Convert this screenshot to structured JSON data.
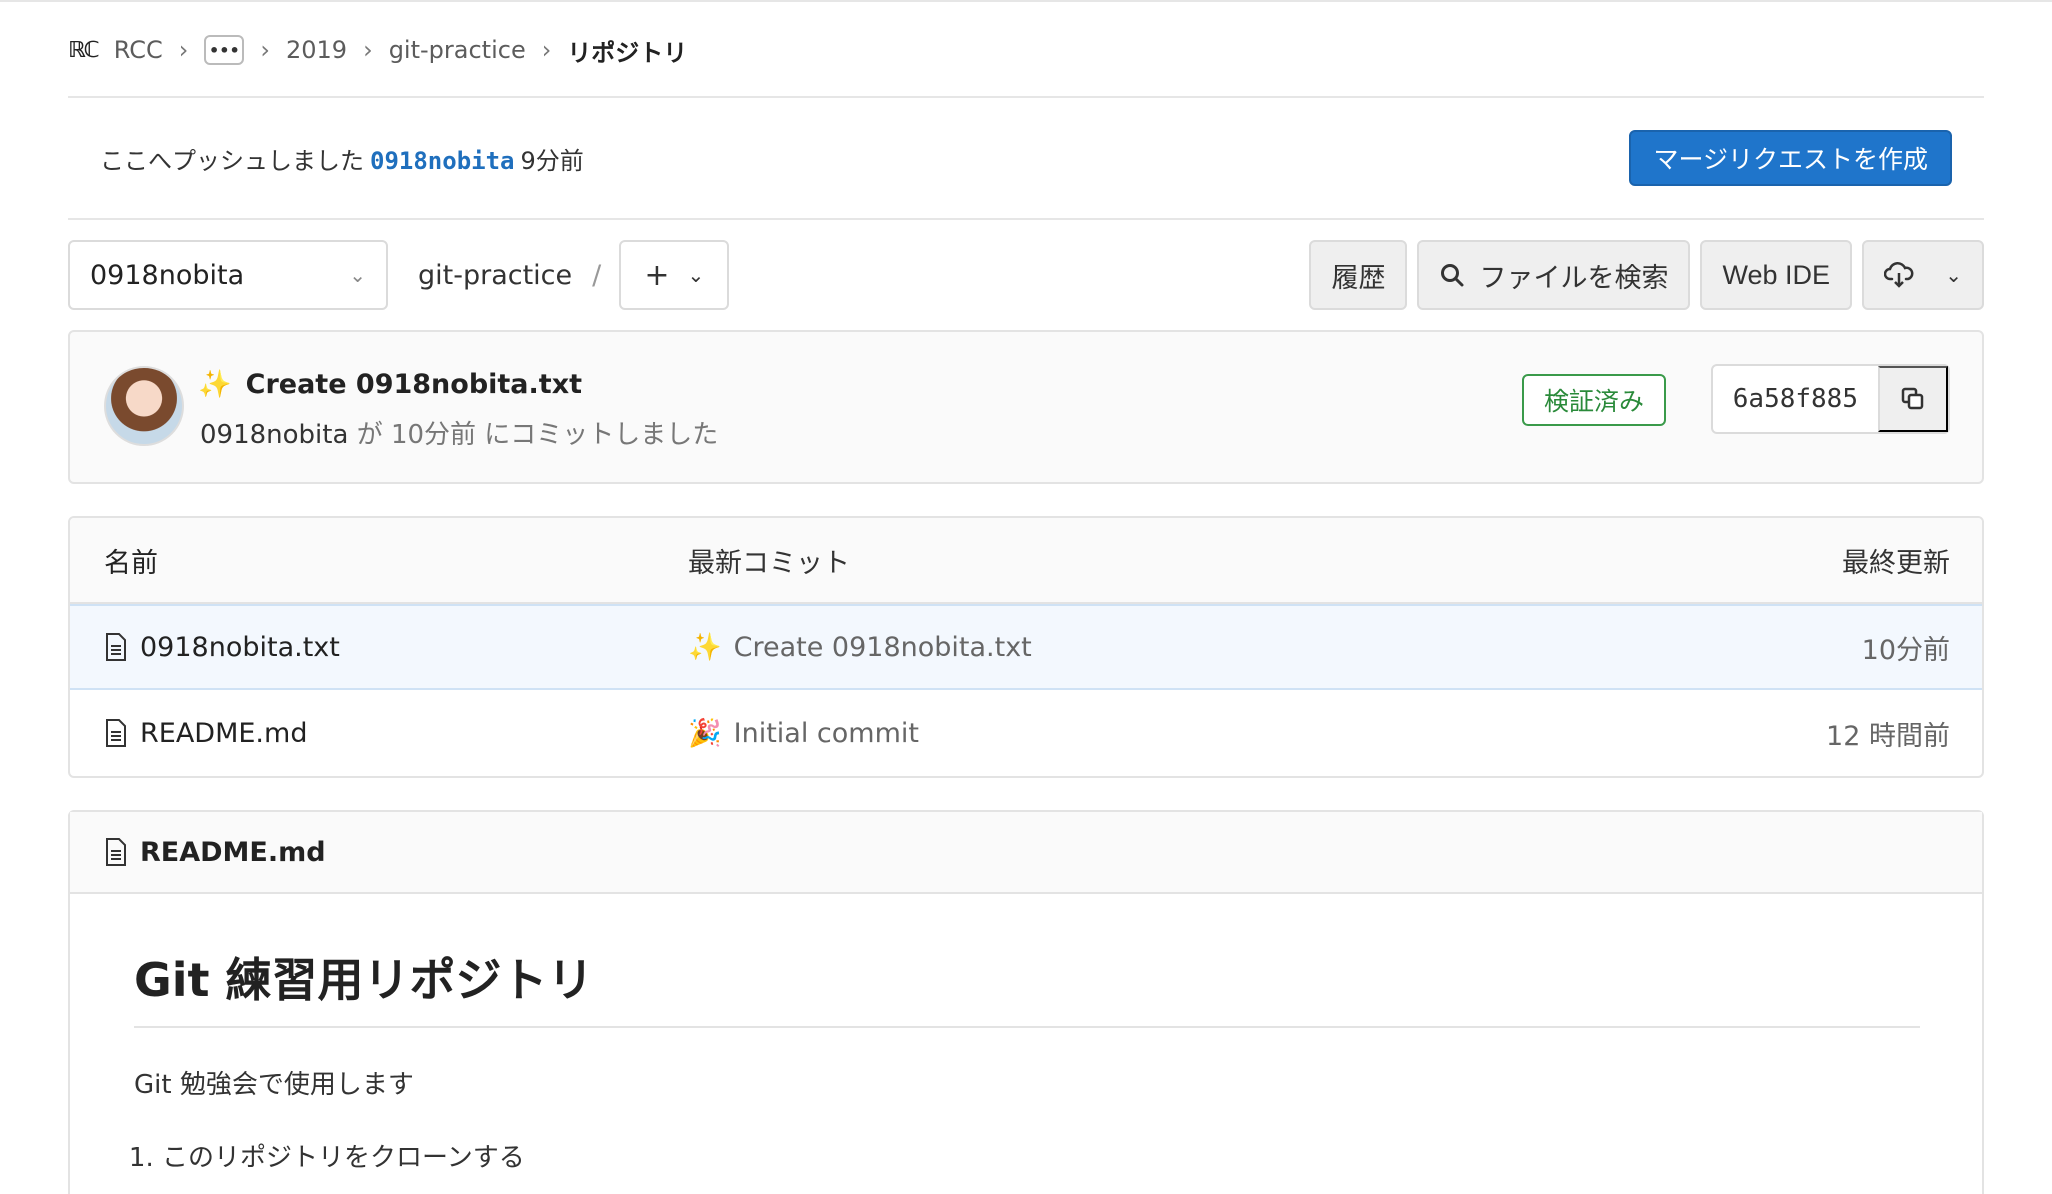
{
  "breadcrumb": {
    "logo": "RCC",
    "group": "RCC",
    "more": "•••",
    "year": "2019",
    "project": "git-practice",
    "current": "リポジトリ"
  },
  "push_banner": {
    "prefix": "ここへプッシュしました",
    "branch": "0918nobita",
    "time": "9分前",
    "mr_button": "マージリクエストを作成"
  },
  "toolbar": {
    "branch": "0918nobita",
    "repo_path": "git-practice",
    "path_sep": "/",
    "add": "+",
    "history": "履歴",
    "find_file": "ファイルを検索",
    "web_ide": "Web IDE"
  },
  "commit": {
    "emoji": "✨",
    "title": "Create 0918nobita.txt",
    "author": "0918nobita",
    "meta": "が 10分前 にコミットしました",
    "verified": "検証済み",
    "sha": "6a58f885"
  },
  "files": {
    "headers": {
      "name": "名前",
      "last_commit": "最新コミット",
      "last_update": "最終更新"
    },
    "rows": [
      {
        "name": "0918nobita.txt",
        "emoji": "✨",
        "commit": "Create 0918nobita.txt",
        "date": "10分前"
      },
      {
        "name": "README.md",
        "emoji": "🎉",
        "commit": "Initial commit",
        "date": "12 時間前"
      }
    ]
  },
  "readme": {
    "filename": "README.md",
    "h1": "Git 練習用リポジトリ",
    "p": "Git 勉強会で使用します",
    "list": [
      "このリポジトリをクローンする"
    ]
  },
  "colors": {
    "primary": "#1f75cb",
    "branch_link": "#1f6fbd",
    "verified": "#2a8a3a",
    "row_highlight": "#f3f8fe"
  }
}
